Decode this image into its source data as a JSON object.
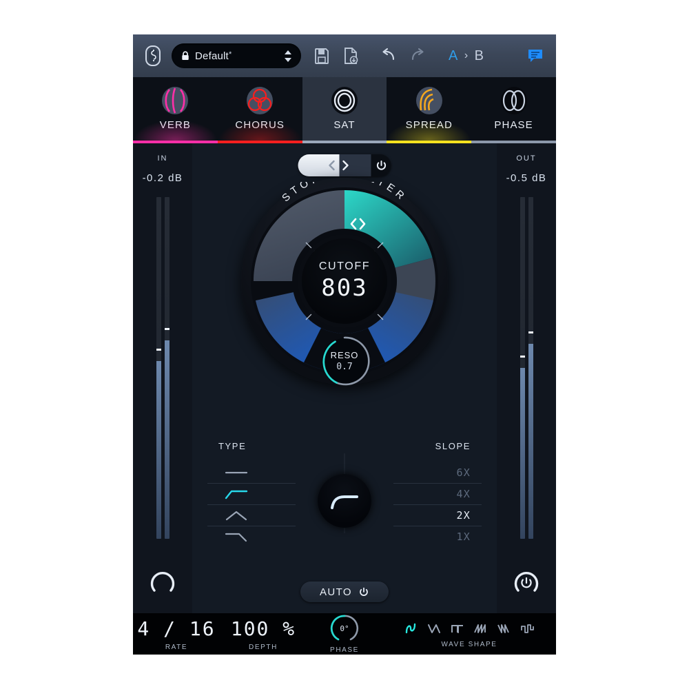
{
  "app": {
    "plugin_title": "STORCH FILTER",
    "accent_cyan": "#27d8cf",
    "accent_blue": "#2f9de8",
    "panel_bg": "#131a24"
  },
  "toolbar": {
    "logo_icon": "storch-logo-icon",
    "lock_icon": "lock-icon",
    "preset_name": "Default",
    "preset_modified_marker": "*",
    "stepper_up_icon": "caret-up-icon",
    "stepper_down_icon": "caret-down-icon",
    "save_icon": "floppy-save-icon",
    "save_as_icon": "save-as-file-icon",
    "undo_icon": "undo-arrow-icon",
    "redo_icon": "redo-arrow-icon",
    "ab_a": "A",
    "ab_sep": "›",
    "ab_b": "B",
    "chat_icon": "chat-bubble-icon"
  },
  "tabs": [
    {
      "label": "VERB",
      "icon": "verb-icon",
      "color": "#ff2fa8",
      "active": false
    },
    {
      "label": "CHORUS",
      "icon": "chorus-icon",
      "color": "#f51f1f",
      "active": false
    },
    {
      "label": "SAT",
      "icon": "sat-icon",
      "color": "#9aa7ba",
      "active": true
    },
    {
      "label": "SPREAD",
      "icon": "spread-icon",
      "color": "#f5e21f",
      "active": false
    },
    {
      "label": "PHASE",
      "icon": "phase-icon",
      "color": "#8c98ab",
      "active": false
    }
  ],
  "input_meter": {
    "title": "IN",
    "value": "-0.2 dB",
    "channels": [
      {
        "level_pct": 52,
        "peak_pct": 55
      },
      {
        "level_pct": 58,
        "peak_pct": 61
      }
    ],
    "knob_icon": "input-gain-knob"
  },
  "output_meter": {
    "title": "OUT",
    "value": "-0.5 dB",
    "channels": [
      {
        "level_pct": 50,
        "peak_pct": 53
      },
      {
        "level_pct": 57,
        "peak_pct": 60
      }
    ],
    "knob_icon": "output-power-knob",
    "power_icon": "power-icon"
  },
  "module_nav": {
    "prev_icon": "chevron-left-icon",
    "next_icon": "chevron-right-icon",
    "power_icon": "power-icon"
  },
  "filter": {
    "title": "STORCH FILTER",
    "cutoff_label": "CUTOFF",
    "cutoff_value": "803",
    "reso_label": "RESO",
    "reso_value": "0.7",
    "reso_arc_pct": 62,
    "handle_icon": "drag-handle-icon"
  },
  "type_section": {
    "label": "TYPE",
    "options": [
      {
        "icon": "flat-curve-icon",
        "selected": false
      },
      {
        "icon": "lowpass-curve-icon",
        "selected": true
      },
      {
        "icon": "bandpass-curve-icon",
        "selected": false
      },
      {
        "icon": "highpass-curve-icon",
        "selected": false
      }
    ]
  },
  "slope_section": {
    "label": "SLOPE",
    "options": [
      {
        "label": "6X",
        "selected": false
      },
      {
        "label": "4X",
        "selected": false
      },
      {
        "label": "2X",
        "selected": true
      },
      {
        "label": "1X",
        "selected": false
      }
    ]
  },
  "morph_knob": {
    "icon": "lowpass-curve-icon"
  },
  "auto_button": {
    "label": "AUTO",
    "power_icon": "power-icon",
    "enabled": false
  },
  "lfo": {
    "rate": {
      "value": "4 / 16",
      "label": "RATE"
    },
    "depth": {
      "value": "100 %",
      "label": "DEPTH"
    },
    "phase": {
      "value": "0°",
      "label": "PHASE",
      "arc_pct": 50
    },
    "wave": {
      "label": "WAVE SHAPE",
      "shapes": [
        {
          "icon": "sine-wave-icon",
          "selected": true
        },
        {
          "icon": "triangle-wave-icon",
          "selected": false
        },
        {
          "icon": "square-wave-icon",
          "selected": false
        },
        {
          "icon": "saw-up-wave-icon",
          "selected": false
        },
        {
          "icon": "saw-down-wave-icon",
          "selected": false
        },
        {
          "icon": "random-step-icon",
          "selected": false
        }
      ]
    }
  }
}
